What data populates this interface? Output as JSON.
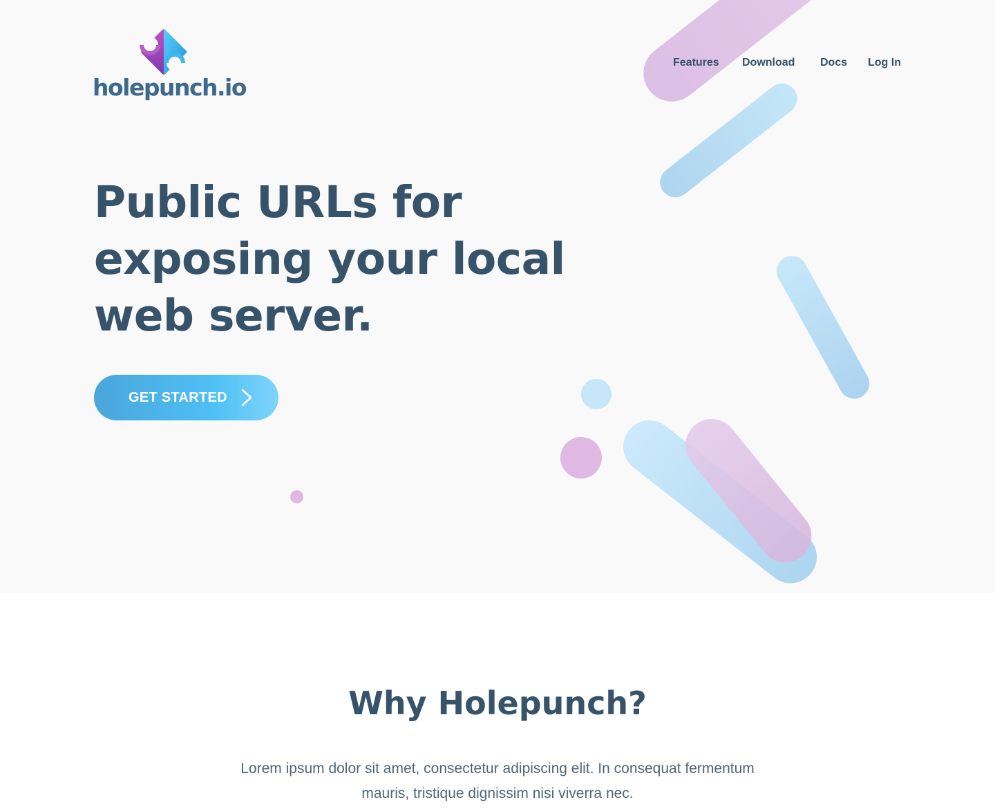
{
  "header": {
    "logo_text": "holepunch.io",
    "nav": [
      "Features",
      "Download",
      "Docs",
      "Log In"
    ]
  },
  "hero": {
    "headline_lines": [
      "Public URLs for",
      "exposing your local",
      "web server."
    ],
    "cta_label": "GET STARTED",
    "cta_icon": "chevron-right-icon"
  },
  "why": {
    "title": "Why Holepunch?",
    "body": "Lorem ipsum dolor sit amet, consectetur adipiscing elit. In consequat fermentum mauris, tristique dignissim nisi viverra nec."
  },
  "colors": {
    "text": "#36536a",
    "accent_blue": "#4ec0f4",
    "accent_pink": "#dfb8e3",
    "hero_bg": "#f9f9fa"
  }
}
